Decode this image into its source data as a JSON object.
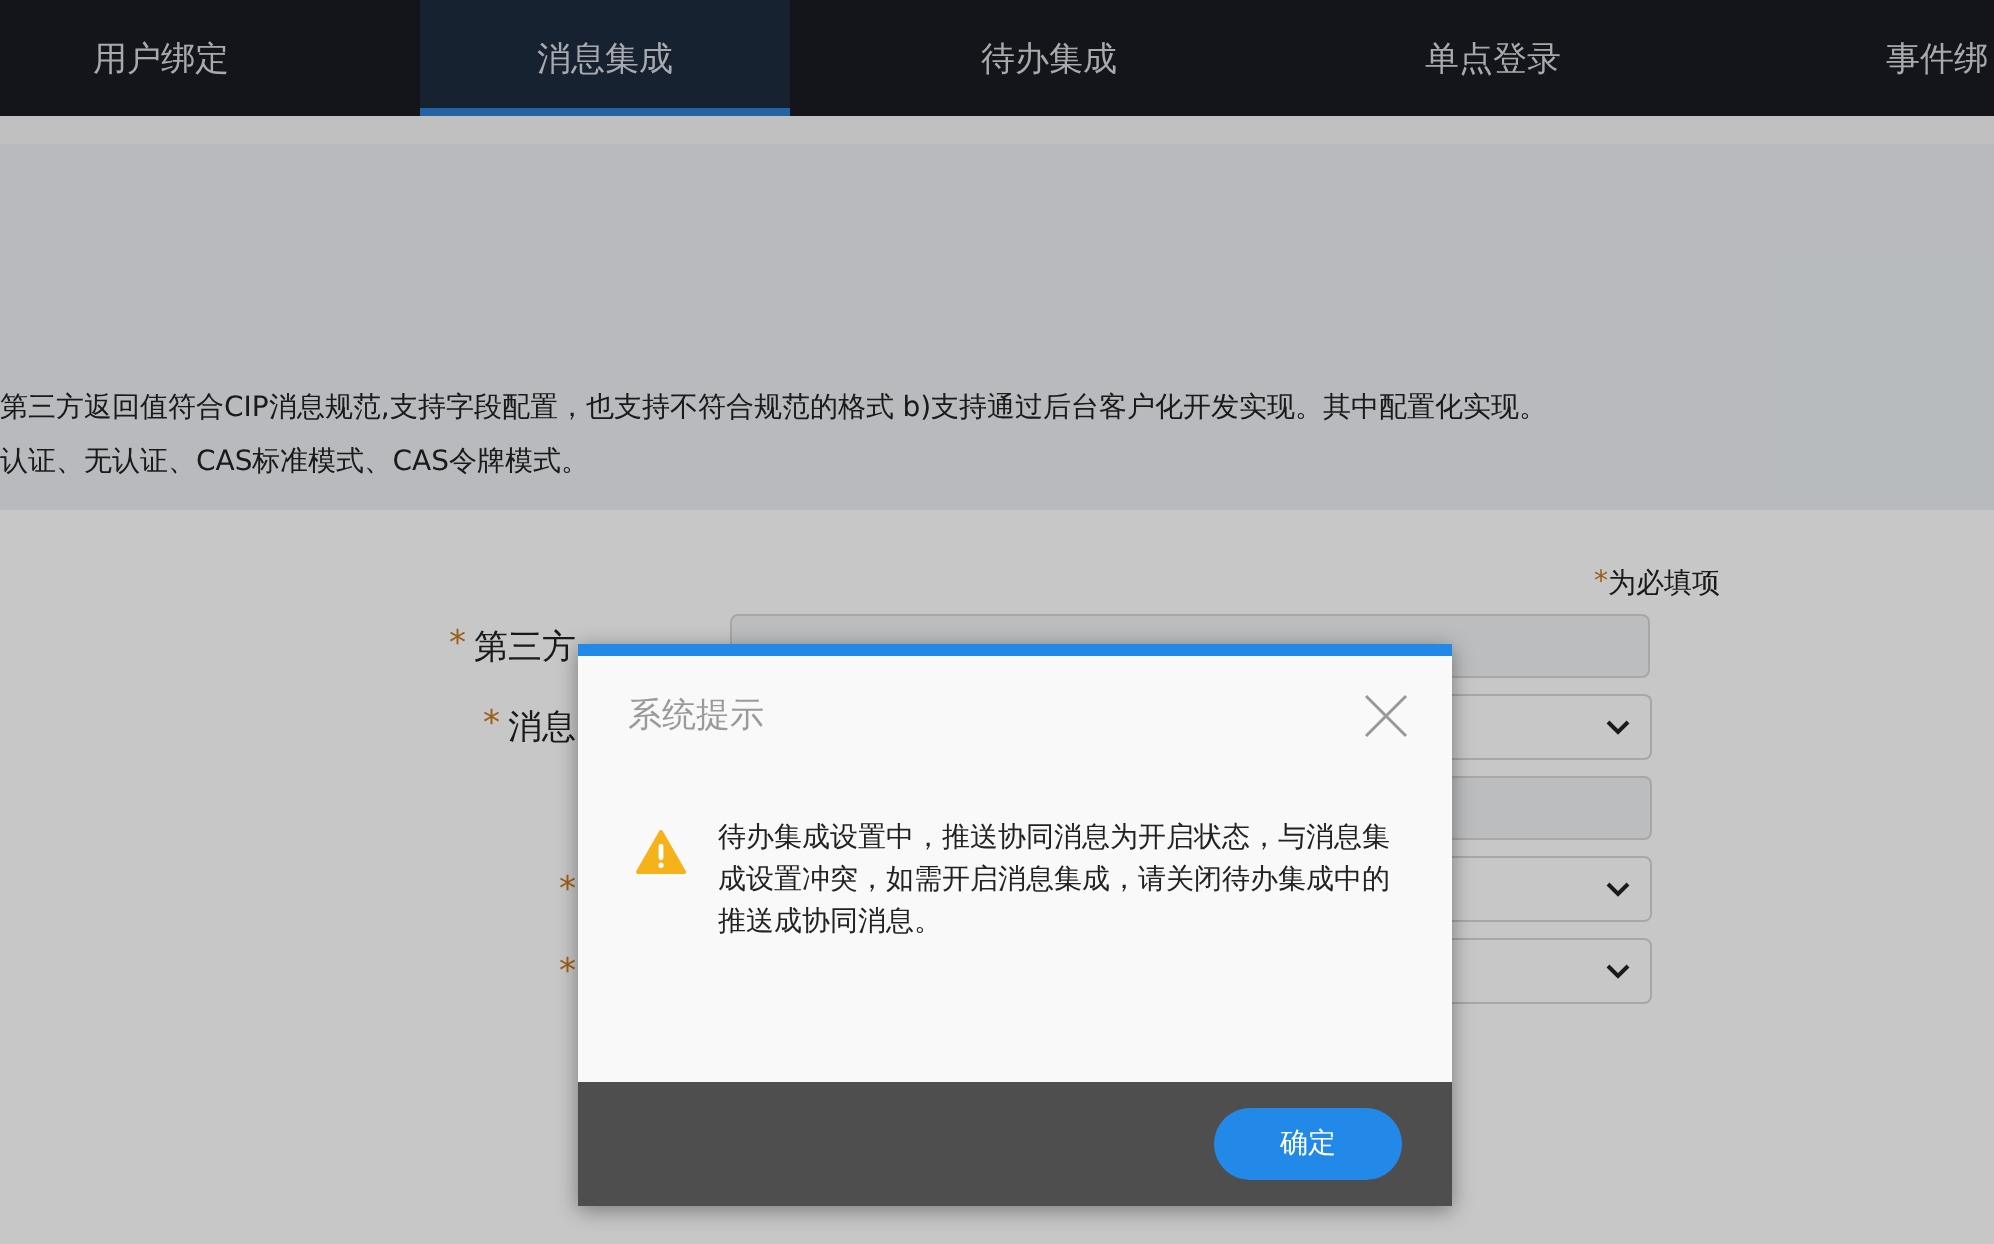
{
  "nav": {
    "tabs": [
      {
        "label": "用户绑定",
        "selected": false
      },
      {
        "label": "消息集成",
        "selected": true
      },
      {
        "label": "待办集成",
        "selected": false
      },
      {
        "label": "单点登录",
        "selected": false
      },
      {
        "label": "事件绑",
        "selected": false
      }
    ]
  },
  "info": {
    "lines": [
      "第三方返回值符合CIP消息规范,支持字段配置，也支持不符合规范的格式 b)支持通过后台客户化开发实现。其中配置化实现。",
      "认证、无认证、CAS标准模式、CAS令牌模式。"
    ]
  },
  "form": {
    "required_mark": "*",
    "required_note": "为必填项",
    "rows": [
      {
        "required": true,
        "label": "第三方",
        "kind": "input"
      },
      {
        "required": true,
        "label": "消息",
        "kind": "select"
      },
      {
        "required": false,
        "kind": "input"
      },
      {
        "required": true,
        "kind": "select"
      },
      {
        "required": true,
        "kind": "select"
      }
    ]
  },
  "dialog": {
    "title": "系统提示",
    "message": "待办集成设置中，推送协同消息为开启状态，与消息集成设置冲突，如需开启消息集成，请关闭待办集成中的推送成协同消息。",
    "buttons": [
      "确定"
    ]
  }
}
